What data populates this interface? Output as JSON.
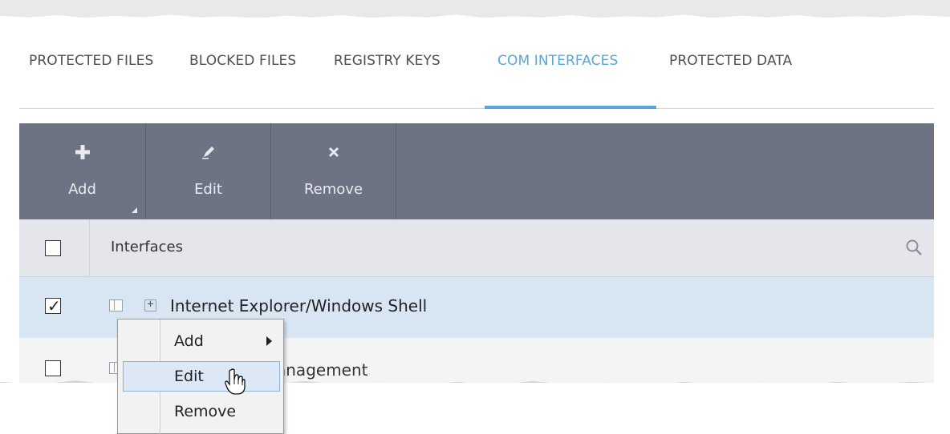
{
  "tabs": [
    {
      "label": "PROTECTED FILES",
      "active": false
    },
    {
      "label": "BLOCKED FILES",
      "active": false
    },
    {
      "label": "REGISTRY KEYS",
      "active": false
    },
    {
      "label": "COM INTERFACES",
      "active": true
    },
    {
      "label": "PROTECTED DATA",
      "active": false
    }
  ],
  "toolbar": {
    "add_label": "Add",
    "edit_label": "Edit",
    "remove_label": "Remove"
  },
  "table": {
    "header": "Interfaces",
    "rows": [
      {
        "name": "Internet Explorer/Windows Shell",
        "checked": true,
        "selected": true
      },
      {
        "name": "anagement",
        "checked": false,
        "selected": false
      }
    ]
  },
  "context_menu": {
    "items": [
      {
        "label": "Add",
        "has_submenu": true
      },
      {
        "label": "Edit",
        "hovered": true
      },
      {
        "label": "Remove"
      }
    ]
  },
  "colors": {
    "accent": "#5aa6d8",
    "toolbar_bg": "#6d7382",
    "selected_row": "#d8e6f4"
  }
}
